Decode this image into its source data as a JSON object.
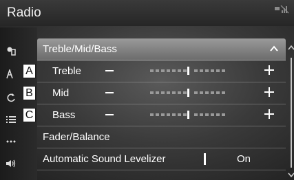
{
  "header": {
    "title": "Radio",
    "status_icon": "signal-icon"
  },
  "left_rail": {
    "icons": [
      "source-icon",
      "sound-settings-icon",
      "refresh-icon",
      "list-icon",
      "more-icon",
      "speaker-icon"
    ]
  },
  "sound_list": {
    "group_label": "Treble/Mid/Bass",
    "eq_rows": [
      {
        "label": "Treble",
        "level": 0,
        "callout": "A"
      },
      {
        "label": "Mid",
        "level": 0,
        "callout": "B"
      },
      {
        "label": "Bass",
        "level": 0,
        "callout": "C"
      }
    ],
    "fader_balance_label": "Fader/Balance",
    "asl_label": "Automatic Sound Levelizer",
    "asl_value": "On"
  },
  "colors": {
    "background": "#3a3a3a",
    "header_row": "#8a8a8a",
    "text": "#ffffff"
  }
}
